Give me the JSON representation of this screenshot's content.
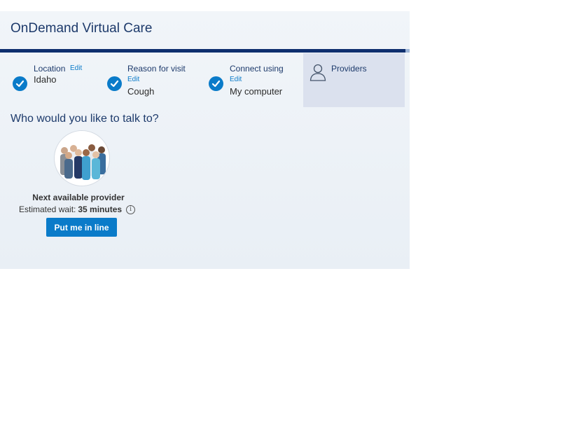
{
  "app": {
    "title": "OnDemand Virtual Care"
  },
  "steps": [
    {
      "label": "Location",
      "edit": "Edit",
      "value": "Idaho"
    },
    {
      "label": "Reason for visit",
      "edit": "Edit",
      "value": "Cough"
    },
    {
      "label": "Connect using",
      "edit": "Edit",
      "value": "My computer"
    },
    {
      "label": "Providers"
    }
  ],
  "main": {
    "question": "Who would you like to talk to?",
    "provider": {
      "name": "Next available provider",
      "wait_label": "Estimated wait:",
      "wait_value": "35 minutes",
      "button": "Put me in line"
    }
  },
  "colors": {
    "accent": "#0a7bc9",
    "navy": "#0e2f6e",
    "active_step": "#dbe1ee"
  },
  "icons": [
    "check-icon",
    "user-outline-icon",
    "info-icon"
  ]
}
